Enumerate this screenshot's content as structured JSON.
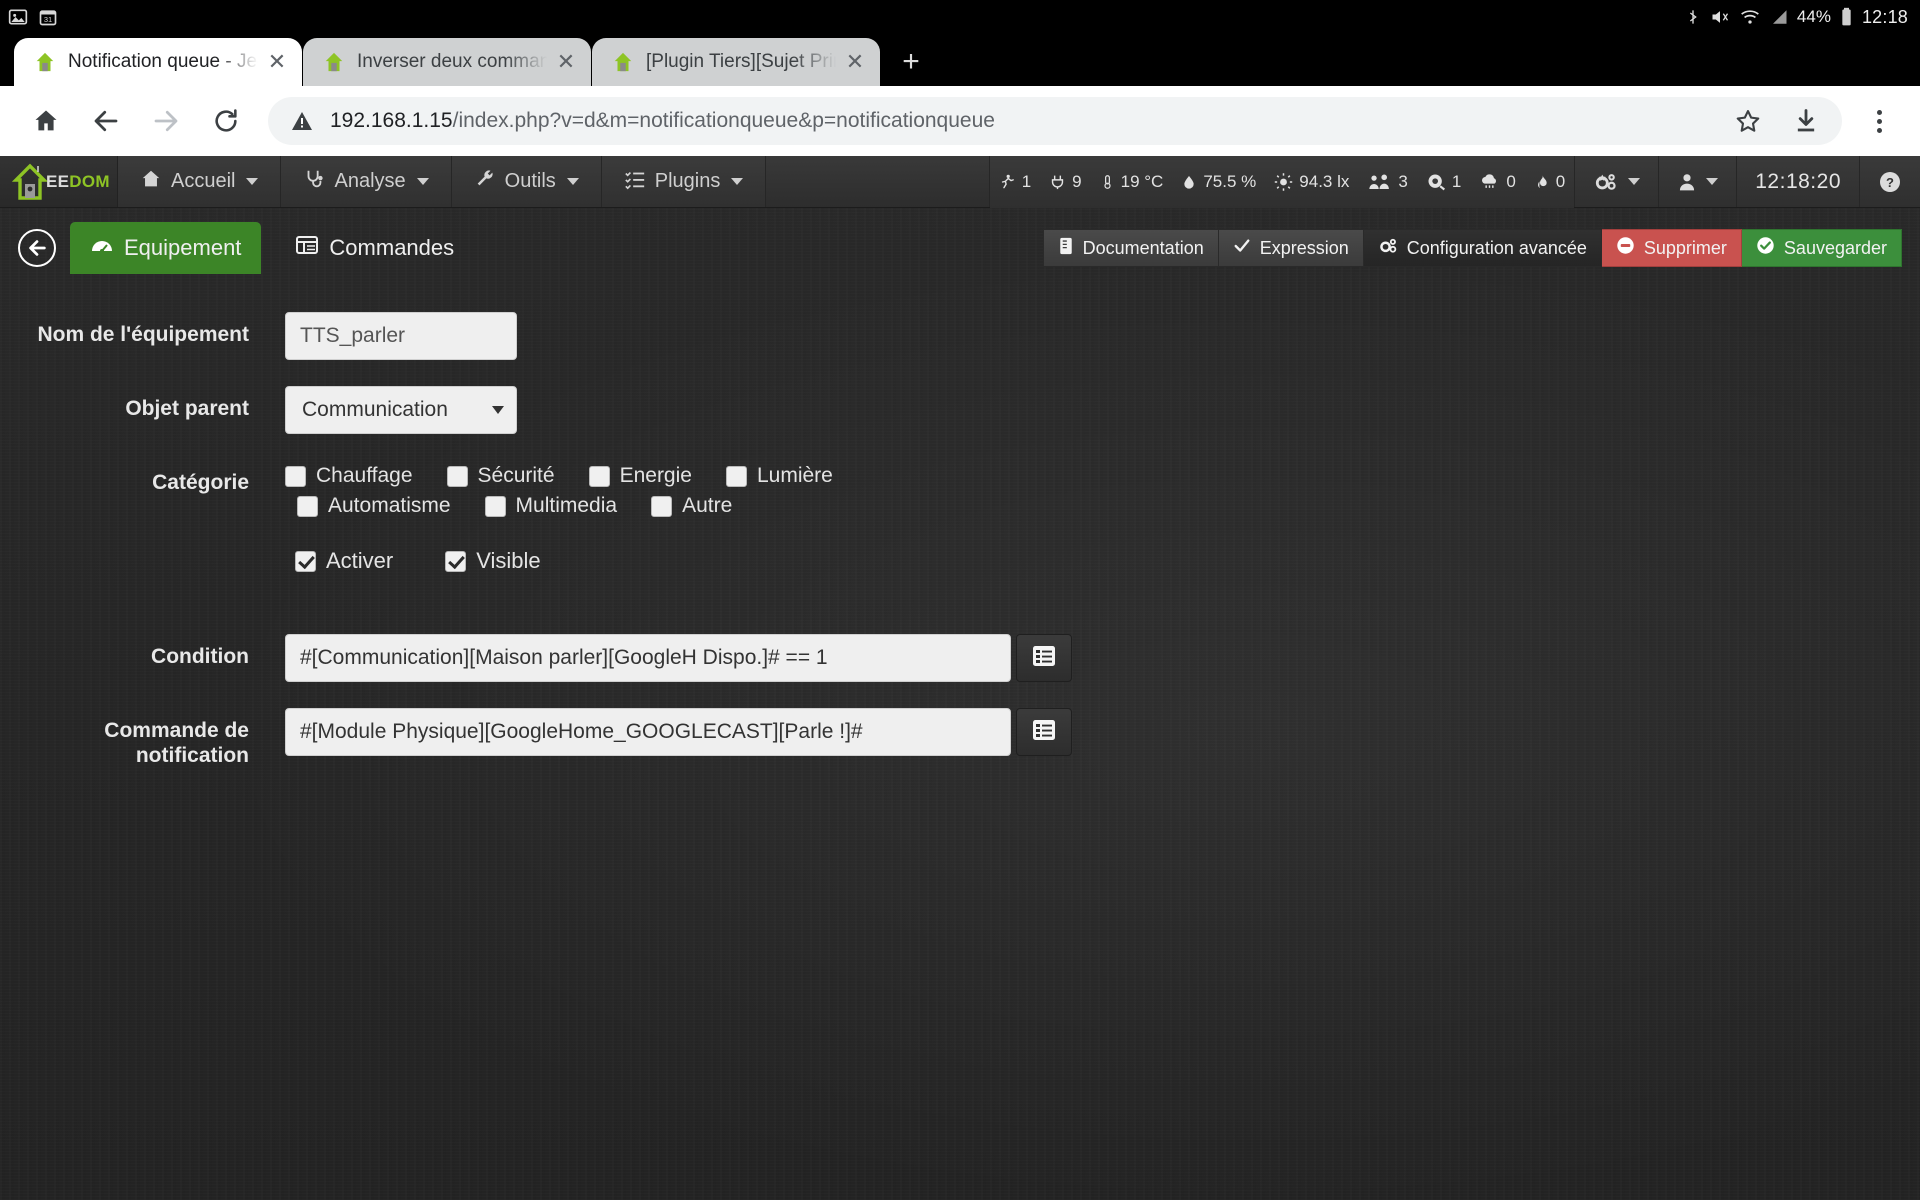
{
  "status_bar": {
    "left_icons": [
      "image-icon",
      "calendar-icon"
    ],
    "right_icons": [
      "bluetooth-icon",
      "mute-icon",
      "wifi-icon",
      "signal-icon"
    ],
    "battery_percent": "44%",
    "time": "12:18"
  },
  "browser": {
    "tabs": [
      {
        "title": "Notification queue - Jeedom",
        "active": true
      },
      {
        "title": "Inverser deux commandes su",
        "active": false
      },
      {
        "title": "[Plugin Tiers][Sujet Principal]",
        "active": false
      }
    ],
    "new_tab_label": "+",
    "close_label": "✕",
    "omnibox": {
      "host": "192.168.1.15",
      "path": "/index.php?v=d&m=notificationqueue&p=notificationqueue",
      "security_icon": "warning-triangle-icon"
    },
    "actions": [
      "home-icon",
      "back-icon",
      "forward-icon",
      "reload-icon",
      "bookmark-star-icon",
      "download-icon",
      "menu-icon"
    ]
  },
  "jeedom": {
    "brand": {
      "text_white": "EE",
      "text_green": "DOM"
    },
    "nav": [
      {
        "label": "Accueil",
        "icon": "home-icon"
      },
      {
        "label": "Analyse",
        "icon": "stethoscope-icon"
      },
      {
        "label": "Outils",
        "icon": "wrench-icon"
      },
      {
        "label": "Plugins",
        "icon": "list-check-icon"
      }
    ],
    "summary": [
      {
        "icon": "motion-icon",
        "value": "1"
      },
      {
        "icon": "plug-icon",
        "value": "9"
      },
      {
        "icon": "thermometer-icon",
        "value": "19 °C"
      },
      {
        "icon": "humidity-drop-icon",
        "value": "75.5 %"
      },
      {
        "icon": "luminosity-sun-icon",
        "value": "94.3 lx"
      },
      {
        "icon": "people-icon",
        "value": "3"
      },
      {
        "icon": "security-camera-icon",
        "value": "1"
      },
      {
        "icon": "rain-cloud-icon",
        "value": "0"
      },
      {
        "icon": "flame-icon",
        "value": "0"
      }
    ],
    "nav_right": {
      "gear_icon": "gears-icon",
      "user_icon": "user-icon",
      "clock": "12:18:20",
      "help_icon": "help-circle-icon"
    },
    "page_tabs": [
      {
        "label": "Equipement",
        "icon": "tachometer-icon",
        "active": true
      },
      {
        "label": "Commandes",
        "icon": "table-icon",
        "active": false
      }
    ],
    "back_icon": "arrow-circle-left-icon",
    "toolbar_buttons": [
      {
        "label": "Documentation",
        "icon": "book-icon",
        "style": "default"
      },
      {
        "label": "Expression",
        "icon": "check-icon",
        "style": "default"
      },
      {
        "label": "Configuration avancée",
        "icon": "gears-icon",
        "style": "dark"
      },
      {
        "label": "Supprimer",
        "icon": "minus-circle-icon",
        "style": "danger"
      },
      {
        "label": "Sauvegarder",
        "icon": "check-circle-icon",
        "style": "success"
      }
    ],
    "form": {
      "name": {
        "label": "Nom de l'équipement",
        "value": "TTS_parler"
      },
      "parent": {
        "label": "Objet parent",
        "value": "Communication"
      },
      "category": {
        "label": "Catégorie",
        "row1": [
          {
            "label": "Chauffage",
            "checked": false
          },
          {
            "label": "Sécurité",
            "checked": false
          },
          {
            "label": "Energie",
            "checked": false
          },
          {
            "label": "Lumière",
            "checked": false
          }
        ],
        "row2": [
          {
            "label": "Automatisme",
            "checked": false
          },
          {
            "label": "Multimedia",
            "checked": false
          },
          {
            "label": "Autre",
            "checked": false
          }
        ]
      },
      "toggles": [
        {
          "label": "Activer",
          "checked": true
        },
        {
          "label": "Visible",
          "checked": true
        }
      ],
      "condition": {
        "label": "Condition",
        "value": "#[Communication][Maison parler][GoogleH Dispo.]# == 1",
        "picker_icon": "list-icon"
      },
      "command": {
        "label": "Commande de notification",
        "value": "#[Module Physique][GoogleHome_GOOGLECAST][Parle !]#",
        "picker_icon": "list-icon"
      }
    },
    "colors": {
      "green_accent": "#3c8527",
      "danger": "#c9524f",
      "success": "#3c8f3c",
      "brand_green": "#8ec425"
    }
  }
}
